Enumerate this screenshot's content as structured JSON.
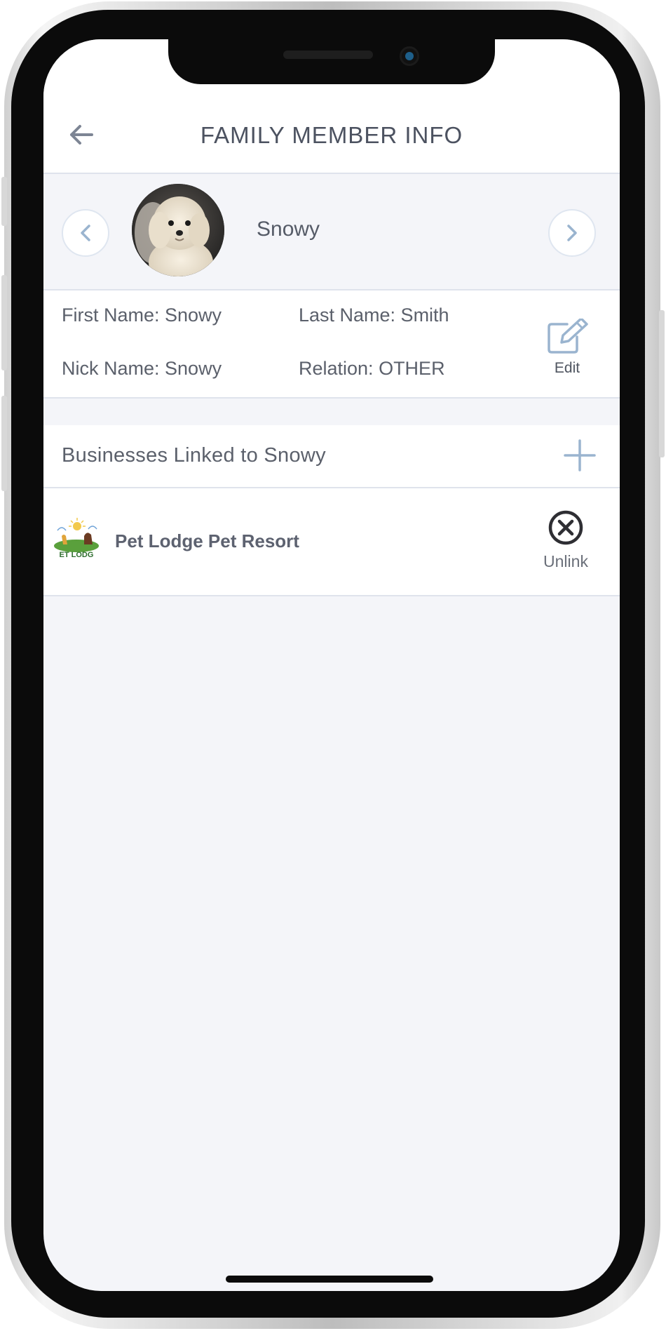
{
  "header": {
    "title": "FAMILY MEMBER INFO",
    "back_icon": "arrow-left-icon"
  },
  "profile": {
    "name": "Snowy",
    "prev_icon": "chevron-left-icon",
    "next_icon": "chevron-right-icon"
  },
  "details": {
    "first_name": "First Name: Snowy",
    "last_name": "Last Name: Smith",
    "nick_name": "Nick Name: Snowy",
    "relation": "Relation: OTHER",
    "edit_label": "Edit"
  },
  "businesses": {
    "title": "Businesses Linked to Snowy",
    "items": [
      {
        "name": "Pet Lodge Pet Resort",
        "logo_text": "ET LODG",
        "unlink_label": "Unlink"
      }
    ]
  },
  "colors": {
    "background": "#f4f5f9",
    "accent": "#9ab4cf",
    "text": "#5b606b"
  }
}
